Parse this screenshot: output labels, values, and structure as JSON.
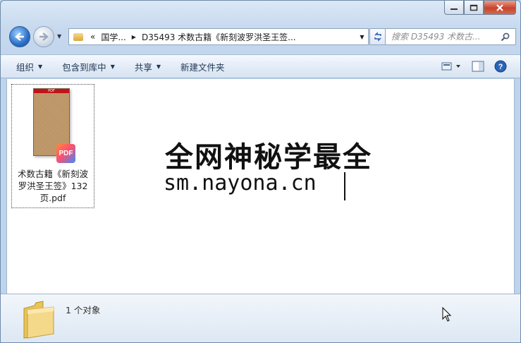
{
  "window": {
    "caption_buttons": [
      "minimize",
      "maximize",
      "close"
    ]
  },
  "nav": {
    "breadcrumb": [
      {
        "label": "«"
      },
      {
        "label": "国学..."
      },
      {
        "label": "D35493 术数古籍《新刻波罗洪圣王签..."
      }
    ],
    "search_placeholder": "搜索 D35493 术数古..."
  },
  "toolbar": {
    "organize": "组织",
    "include_library": "包含到库中",
    "share": "共享",
    "new_folder": "新建文件夹"
  },
  "files": [
    {
      "name": "术数古籍《新刻波罗洪圣王签》132页.pdf",
      "type": "pdf",
      "thumb_band": "PDF",
      "badge": "PDF"
    }
  ],
  "watermark": {
    "line1": "全网神秘学最全",
    "line2": "sm.nayona.cn"
  },
  "details": {
    "count_text": "1 个对象"
  },
  "colors": {
    "accent": "#2c6fc8",
    "close_button": "#c7432a",
    "pdf_band": "#c0141b"
  }
}
